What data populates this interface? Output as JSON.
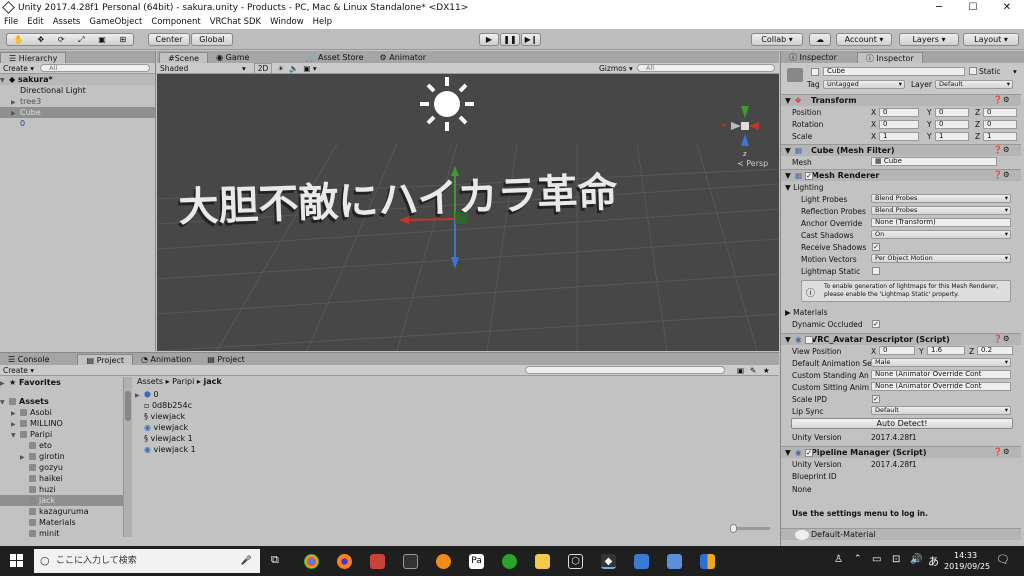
{
  "window": {
    "title": "Unity 2017.4.28f1 Personal (64bit) - sakura.unity - Products - PC, Mac & Linux Standalone* <DX11>"
  },
  "menu": [
    "File",
    "Edit",
    "Assets",
    "GameObject",
    "Component",
    "VRChat SDK",
    "Window",
    "Help"
  ],
  "toolbar": {
    "center": "Center",
    "global": "Global",
    "collab": "Collab",
    "account": "Account",
    "layers": "Layers",
    "layout": "Layout"
  },
  "hierarchy": {
    "tab": "Hierarchy",
    "create": "Create",
    "search_placeholder": "All",
    "scene": "sakura*",
    "items": [
      "Directional Light",
      "tree3",
      "Cube",
      "0"
    ]
  },
  "scene": {
    "tabs": [
      "Scene",
      "Game",
      "Asset Store",
      "Animator"
    ],
    "shading": "Shaded",
    "mode2d": "2D",
    "gizmos": "Gizmos",
    "search_placeholder": "All",
    "text3d": "大胆不敵にハイカラ革命",
    "persp": "Persp",
    "axis_y": "y",
    "axis_z": "z"
  },
  "project": {
    "tabs": [
      "Console",
      "Project",
      "Animation",
      "Project"
    ],
    "create": "Create",
    "favorites": "Favorites",
    "assets": "Assets",
    "tree": [
      "Asobi",
      "MILLINO",
      "Paripi",
      "eto",
      "girotin",
      "gozyu",
      "haikei",
      "huzi",
      "jack",
      "kazaguruma",
      "Materials",
      "minit"
    ],
    "breadcrumb": [
      "Assets",
      "Paripi",
      "jack"
    ],
    "files": [
      "0",
      "0d8b254c",
      "viewjack",
      "viewjack",
      "viewjack 1",
      "viewjack 1"
    ]
  },
  "inspector": {
    "tabs": [
      "Inspector",
      "Inspector"
    ],
    "object_name": "Cube",
    "static_label": "Static",
    "tag_label": "Tag",
    "tag": "Untagged",
    "layer_label": "Layer",
    "layer": "Default",
    "transform": {
      "title": "Transform",
      "rows": [
        {
          "label": "Position",
          "x": "0",
          "y": "0",
          "z": "0"
        },
        {
          "label": "Rotation",
          "x": "0",
          "y": "0",
          "z": "0"
        },
        {
          "label": "Scale",
          "x": "1",
          "y": "1",
          "z": "1"
        }
      ]
    },
    "mesh_filter": {
      "title": "Cube (Mesh Filter)",
      "mesh_label": "Mesh",
      "mesh": "Cube"
    },
    "mesh_renderer": {
      "title": "Mesh Renderer",
      "lighting": "Lighting",
      "light_probes_label": "Light Probes",
      "light_probes": "Blend Probes",
      "reflection_probes_label": "Reflection Probes",
      "reflection_probes": "Blend Probes",
      "anchor_label": "Anchor Override",
      "anchor": "None (Transform)",
      "cast_label": "Cast Shadows",
      "cast": "On",
      "receive_label": "Receive Shadows",
      "motion_label": "Motion Vectors",
      "motion": "Per Object Motion",
      "lightmap_label": "Lightmap Static",
      "info": "To enable generation of lightmaps for this Mesh Renderer, please enable the 'Lightmap Static' property.",
      "materials": "Materials",
      "dynamic_label": "Dynamic Occluded"
    },
    "avatar": {
      "title": "VRC_Avatar Descriptor (Script)",
      "view_label": "View Position",
      "vx": "0",
      "vy": "1.6",
      "vz": "0.2",
      "default_anim_label": "Default Animation Se",
      "default_anim": "Male",
      "standing_label": "Custom Standing An",
      "standing": "None (Animator Override Cont",
      "sitting_label": "Custom Sitting Anim",
      "sitting": "None (Animator Override Cont",
      "scale_label": "Scale IPD",
      "lip_label": "Lip Sync",
      "lip": "Default",
      "auto_detect": "Auto Detect!",
      "unity_version_label": "Unity Version",
      "unity_version": "2017.4.28f1"
    },
    "pipeline": {
      "title": "Pipeline Manager (Script)",
      "unity_version_label": "Unity Version",
      "unity_version": "2017.4.28f1",
      "blueprint_label": "Blueprint ID",
      "blueprint": "None",
      "settings_msg": "Use the settings menu to log in."
    },
    "default_material": "Default-Material"
  },
  "taskbar": {
    "search_placeholder": "ここに入力して検索",
    "ime": "あ",
    "time": "14:33",
    "date": "2019/09/25"
  },
  "colors": {
    "scene_bg": "#474747",
    "taskbar": "#1f1f1f",
    "selection": "#8f8f8f"
  }
}
